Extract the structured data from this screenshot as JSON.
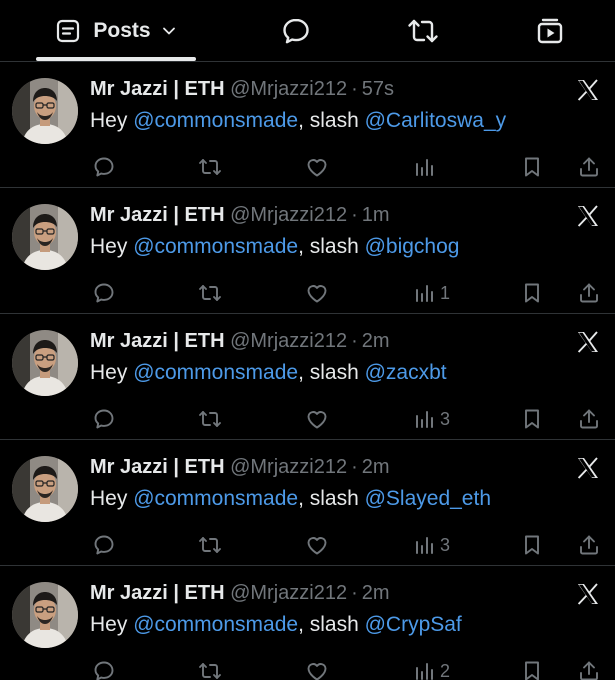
{
  "tabs": {
    "posts_label": "Posts",
    "icons": [
      "posts-icon",
      "chevron-down-icon",
      "replies-icon",
      "reposts-icon",
      "media-icon"
    ]
  },
  "colors": {
    "background": "#000000",
    "text": "#e7e9ea",
    "secondary": "#71767b",
    "mention": "#4d9ae8",
    "divider": "#2f3336"
  },
  "tweets": [
    {
      "name": "Mr Jazzi | ETH",
      "handle": "@Mrjazzi212",
      "dot": "·",
      "time": "57s",
      "text_prefix": "Hey ",
      "mention1": "@commonsmade",
      "text_middle": ", slash ",
      "mention2": "@Carlitoswa_y",
      "views": ""
    },
    {
      "name": "Mr Jazzi | ETH",
      "handle": "@Mrjazzi212",
      "dot": "·",
      "time": "1m",
      "text_prefix": "Hey ",
      "mention1": "@commonsmade",
      "text_middle": ", slash ",
      "mention2": "@bigchog",
      "views": "1"
    },
    {
      "name": "Mr Jazzi | ETH",
      "handle": "@Mrjazzi212",
      "dot": "·",
      "time": "2m",
      "text_prefix": "Hey ",
      "mention1": "@commonsmade",
      "text_middle": ", slash ",
      "mention2": "@zacxbt",
      "views": "3"
    },
    {
      "name": "Mr Jazzi | ETH",
      "handle": "@Mrjazzi212",
      "dot": "·",
      "time": "2m",
      "text_prefix": "Hey ",
      "mention1": "@commonsmade",
      "text_middle": ", slash ",
      "mention2": "@Slayed_eth",
      "views": "3"
    },
    {
      "name": "Mr Jazzi | ETH",
      "handle": "@Mrjazzi212",
      "dot": "·",
      "time": "2m",
      "text_prefix": "Hey ",
      "mention1": "@commonsmade",
      "text_middle": ", slash ",
      "mention2": "@CrypSaf",
      "views": "2"
    }
  ]
}
